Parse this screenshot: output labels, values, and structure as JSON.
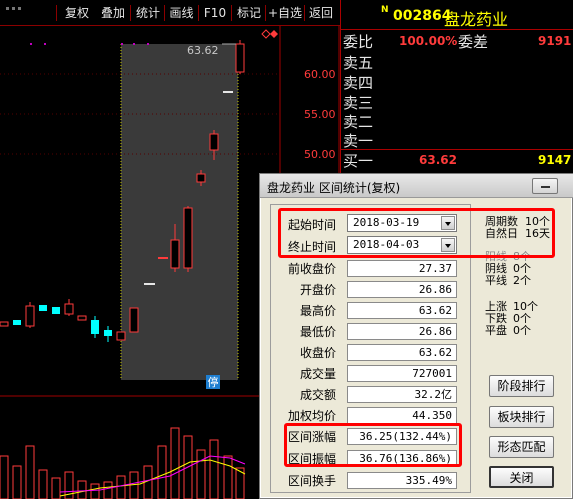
{
  "toolbar": {
    "buttons": [
      "复权",
      "叠加",
      "统计",
      "画线",
      "F10",
      "标记",
      "+自选",
      "返回"
    ]
  },
  "quote": {
    "marker": "N",
    "code": "002864",
    "name": "盘龙药业",
    "rows": [
      {
        "label": "委比",
        "value": "100.00%",
        "label2": "委差",
        "value2": "9191"
      },
      {
        "label": "卖五"
      },
      {
        "label": "卖四"
      },
      {
        "label": "卖三"
      },
      {
        "label": "卖二"
      },
      {
        "label": "卖一"
      },
      {
        "label": "买一",
        "value": "63.62",
        "value2": "9147"
      }
    ]
  },
  "chart": {
    "price_labels": [
      "60.00",
      "55.00",
      "50.00"
    ],
    "high_annotation": "63.62",
    "suspend_marker": "停"
  },
  "chart_data": {
    "type": "candlestick",
    "y_ticks": [
      50.0,
      55.0,
      60.0
    ],
    "high_marker": 63.62
  },
  "colors": {
    "up": "#ff3b3b",
    "down": "#00ffff",
    "highlight": "#ff0000",
    "selection": "#3a3a3a"
  },
  "dialog": {
    "title": "盘龙药业 区间统计(复权)",
    "start_label": "起始时间",
    "start_value": "2018-03-19",
    "end_label": "终止时间",
    "end_value": "2018-04-03",
    "periods_label": "周期数",
    "periods_value": "10个",
    "natural_days_label": "自然日",
    "natural_days_value": "16天",
    "fields": [
      {
        "label": "前收盘价",
        "value": "27.37"
      },
      {
        "label": "开盘价",
        "value": "26.86"
      },
      {
        "label": "最高价",
        "value": "63.62"
      },
      {
        "label": "最低价",
        "value": "26.86"
      },
      {
        "label": "收盘价",
        "value": "63.62"
      },
      {
        "label": "成交量",
        "value": "727001"
      },
      {
        "label": "成交额",
        "value": "32.2亿"
      },
      {
        "label": "加权均价",
        "value": "44.350"
      },
      {
        "label": "区间涨幅",
        "value": "36.25(132.44%)"
      },
      {
        "label": "区间振幅",
        "value": "36.76(136.86%)"
      },
      {
        "label": "区间换手",
        "value": "335.49%"
      }
    ],
    "counts": [
      {
        "label": "阳线",
        "value": "8个"
      },
      {
        "label": "阴线",
        "value": "0个"
      },
      {
        "label": "平线",
        "value": "2个"
      },
      {
        "label": "上涨",
        "value": "10个"
      },
      {
        "label": "下跌",
        "value": "0个"
      },
      {
        "label": "平盘",
        "value": "0个"
      }
    ],
    "buttons": {
      "phase_rank": "阶段排行",
      "sector_rank": "板块排行",
      "pattern_match": "形态匹配",
      "close": "关闭"
    }
  }
}
